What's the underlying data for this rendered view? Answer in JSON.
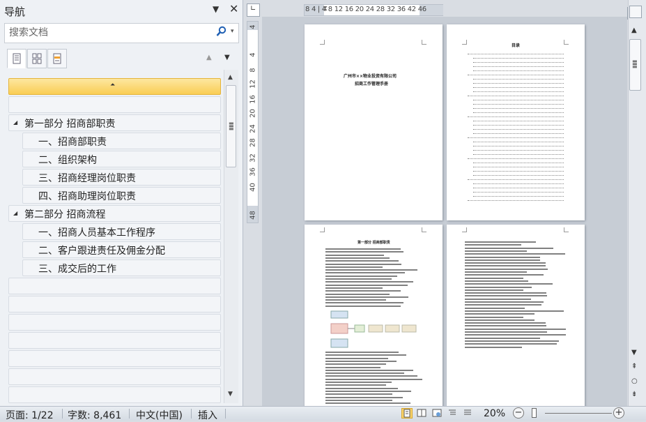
{
  "nav": {
    "title": "导航",
    "search_placeholder": "搜索文档",
    "headings": [
      {
        "label": "第一部分 招商部职责",
        "level": 1
      },
      {
        "label": "一、招商部职责",
        "level": 2
      },
      {
        "label": "二、组织架构",
        "level": 2
      },
      {
        "label": "三、招商经理岗位职责",
        "level": 2
      },
      {
        "label": "四、招商助理岗位职责",
        "level": 2
      },
      {
        "label": "第二部分 招商流程",
        "level": 1
      },
      {
        "label": "一、招商人员基本工作程序",
        "level": 2
      },
      {
        "label": "二、客户跟进责任及佣金分配",
        "level": 2
      },
      {
        "label": "三、成交后的工作",
        "level": 2
      }
    ]
  },
  "rulers": {
    "horizontal_labels": "8  4  |  4  8  12 16 20 24 28 32 36  42 46",
    "vertical_labels": [
      "4",
      "4",
      "8",
      "12",
      "16",
      "20",
      "24",
      "28",
      "32",
      "36",
      "40",
      "48"
    ]
  },
  "document": {
    "cover_title_line1": "广州市××物业投资有限公司",
    "cover_title_line2": "招商工作管理手册",
    "toc_heading": "目录",
    "page3_heading": "第一部分 招商部职责"
  },
  "status": {
    "page": "页面: 1/22",
    "words": "字数: 8,461",
    "language": "中文(中国)",
    "mode": "插入",
    "zoom": "20%"
  },
  "colors": {
    "selected_row": "#f9cd54",
    "pane_bg": "#eef1f5",
    "workspace_bg": "#c7cdd5"
  }
}
